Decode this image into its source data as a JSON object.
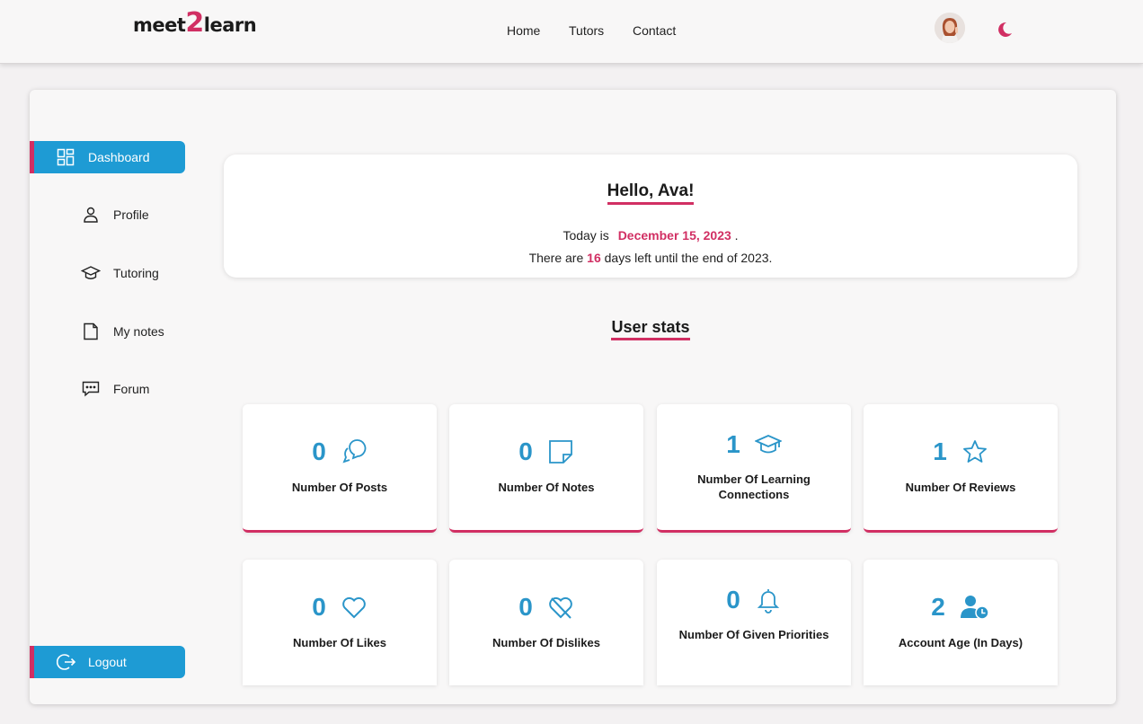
{
  "navbar": {
    "logo_left": "meet",
    "logo_mid": "2",
    "logo_right": "learn",
    "links": [
      "Home",
      "Tutors",
      "Contact"
    ]
  },
  "sidebar": {
    "items": [
      {
        "label": "Dashboard",
        "icon": "grid-icon",
        "active": true
      },
      {
        "label": "Profile",
        "icon": "user-icon"
      },
      {
        "label": "Tutoring",
        "icon": "graduation-cap-icon"
      },
      {
        "label": "My notes",
        "icon": "note-icon"
      },
      {
        "label": "Forum",
        "icon": "chat-icon"
      }
    ],
    "logout_label": "Logout"
  },
  "greeting": {
    "title": "Hello, Ava!",
    "today_prefix": "Today is",
    "date": "December 15, 2023",
    "today_suffix": ".",
    "days_prefix": "There are",
    "days_left": "16",
    "days_suffix": "days left until the end of 2023."
  },
  "stats_title": "User stats",
  "stats": [
    {
      "value": "0",
      "label": "Number Of Posts",
      "icon": "chat-bubbles-icon"
    },
    {
      "value": "0",
      "label": "Number Of Notes",
      "icon": "sticky-note-icon"
    },
    {
      "value": "1",
      "label": "Number Of Learning Connections",
      "icon": "graduation-cap-icon"
    },
    {
      "value": "1",
      "label": "Number Of Reviews",
      "icon": "star-icon"
    },
    {
      "value": "0",
      "label": "Number Of Likes",
      "icon": "heart-icon"
    },
    {
      "value": "0",
      "label": "Number Of Dislikes",
      "icon": "heart-crossed-icon"
    },
    {
      "value": "0",
      "label": "Number Of Given Priorities",
      "icon": "bell-icon"
    },
    {
      "value": "2",
      "label": "Account Age (In Days)",
      "icon": "user-clock-icon"
    }
  ],
  "colors": {
    "accent": "#d12f63",
    "primary": "#1e9bd4",
    "stat_value": "#2a95c9"
  }
}
